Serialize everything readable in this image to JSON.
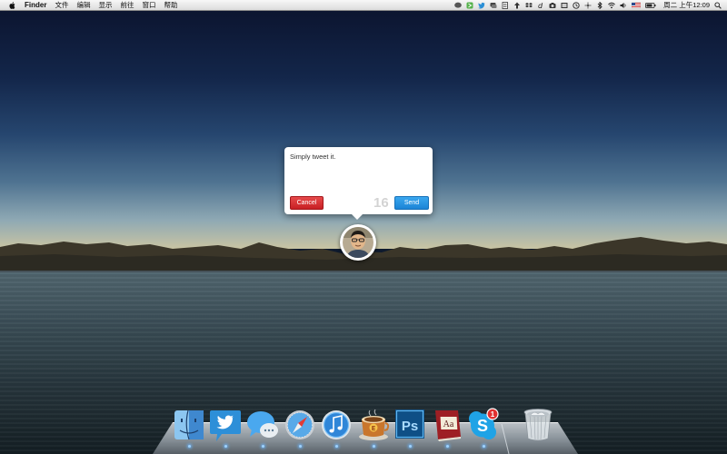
{
  "menubar": {
    "app_name": "Finder",
    "menus": [
      "文件",
      "编辑",
      "显示",
      "前往",
      "窗口",
      "帮助"
    ],
    "clock": "周二 上午12:09",
    "tray_icons": [
      "chat-bubble-icon",
      "evernote-icon",
      "twitter-icon",
      "chat-icon",
      "document-icon",
      "transmit-icon",
      "dropbox-icon",
      "delicious-icon",
      "camera-icon",
      "cinema-icon",
      "time-machine-icon",
      "sync-icon",
      "bluetooth-icon",
      "wifi-icon",
      "volume-icon",
      "flag-icon",
      "battery-icon",
      "spotlight-icon"
    ]
  },
  "tweet": {
    "text": "Simply tweet it.",
    "cancel_label": "Cancel",
    "send_label": "Send",
    "char_count": "16"
  },
  "dock": {
    "apps": [
      "finder-icon",
      "twitter-app-icon",
      "messages-icon",
      "safari-icon",
      "itunes-icon",
      "espresso-icon",
      "photoshop-icon",
      "dictionary-icon",
      "skype-icon",
      "trash-icon"
    ],
    "photoshop_label": "Ps",
    "dictionary_label": "Aa",
    "skype_badge": "1",
    "espresso_label": "E"
  },
  "colors": {
    "cancel": "#d9272e",
    "send": "#2b97e6",
    "count": "#d3d3d3"
  }
}
